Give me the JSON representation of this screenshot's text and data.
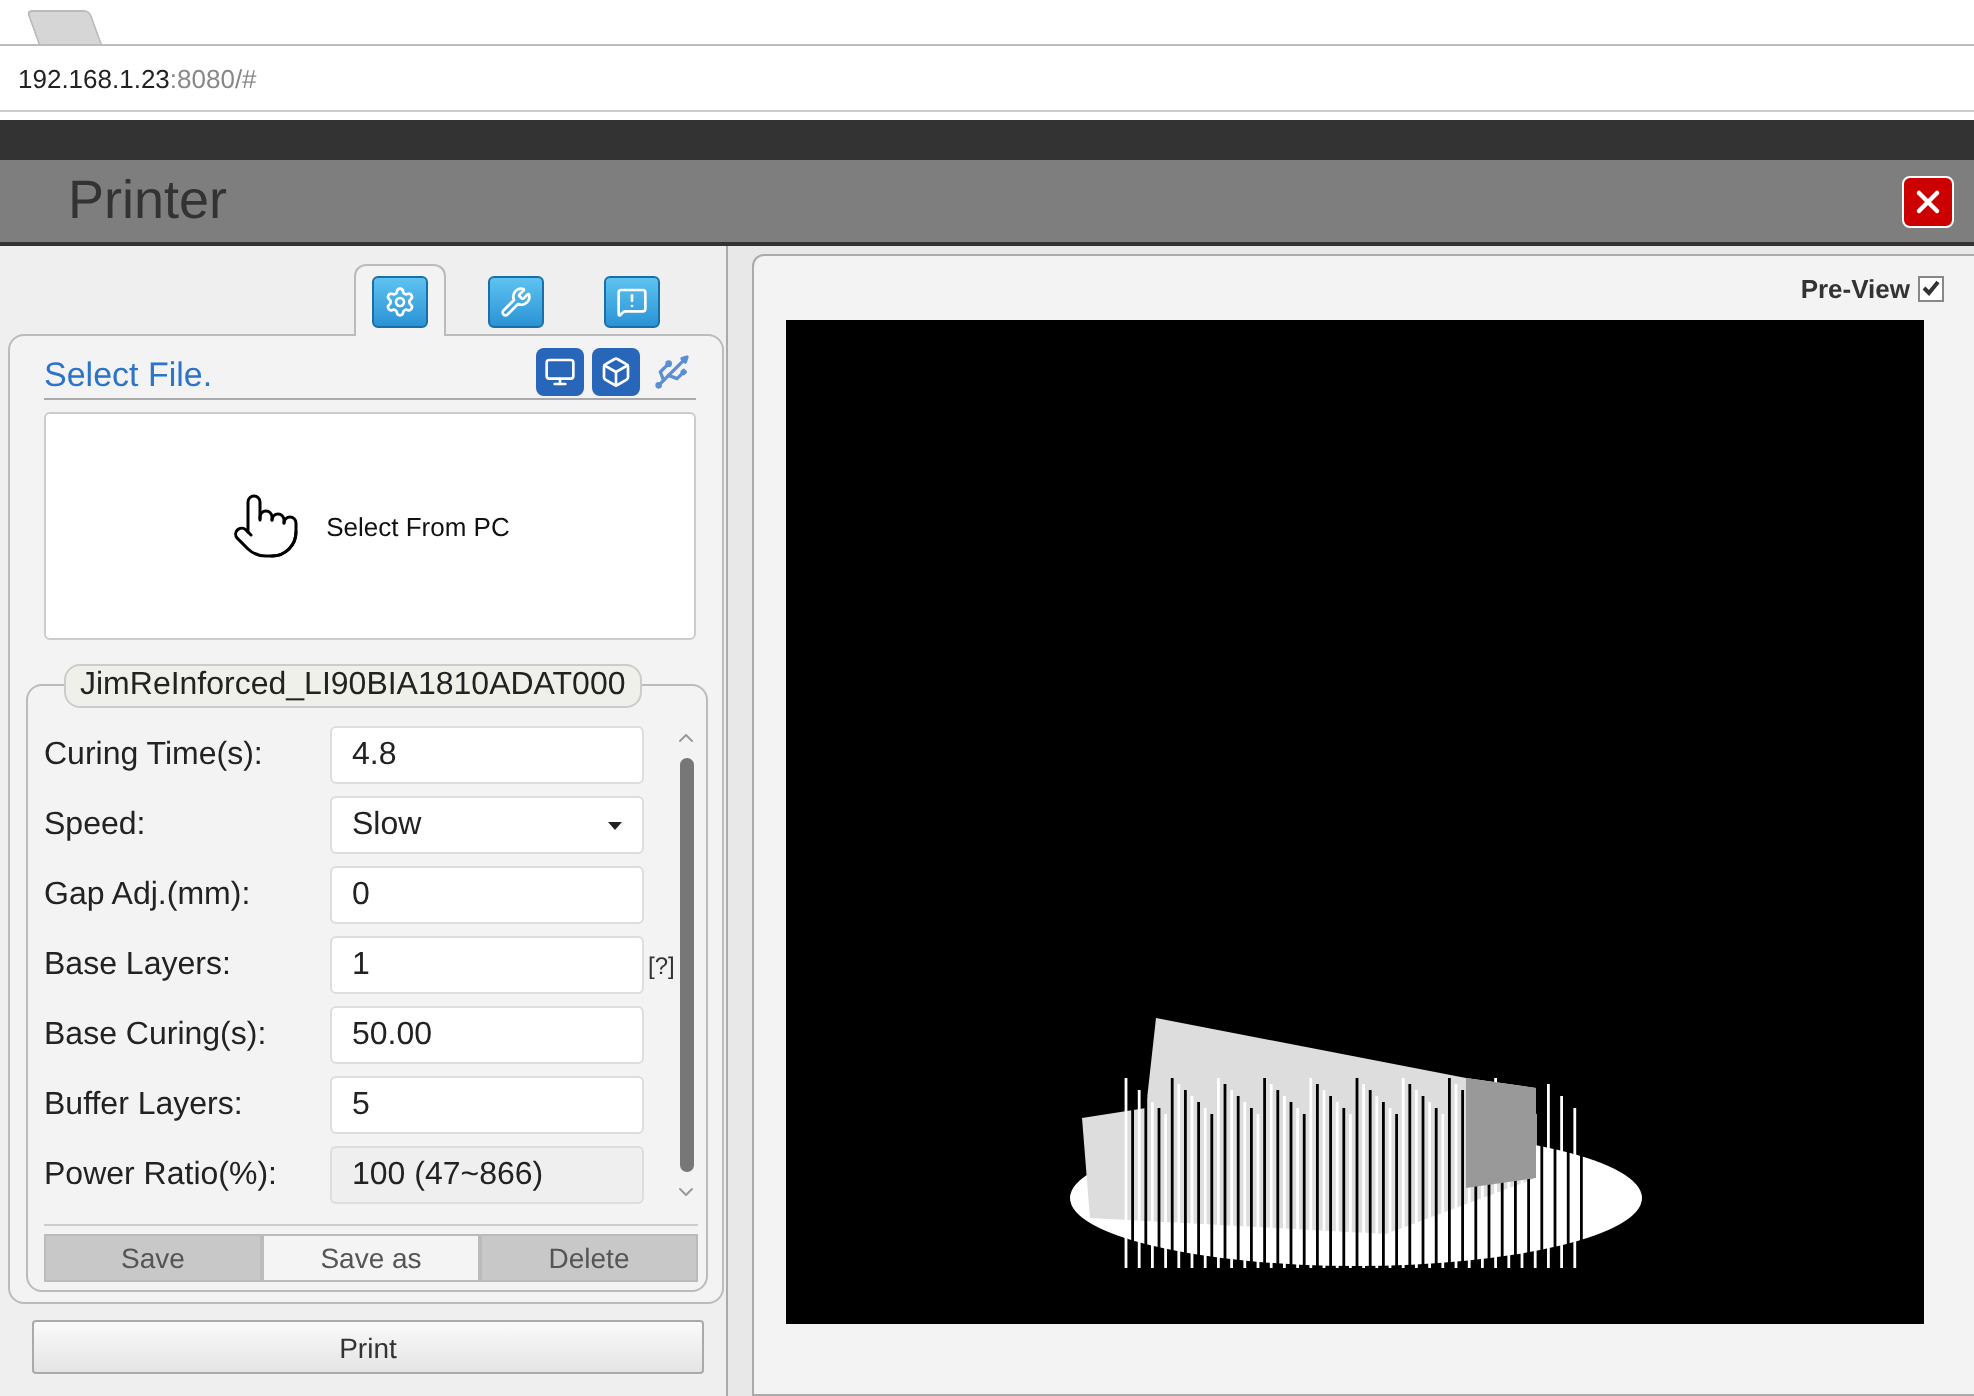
{
  "browser": {
    "url_host": "192.168.1.23",
    "url_rest": ":8080/#"
  },
  "window": {
    "title": "Printer"
  },
  "tabs": [
    {
      "kind": "settings",
      "selected": true
    },
    {
      "kind": "tools",
      "selected": false
    },
    {
      "kind": "info",
      "selected": false
    }
  ],
  "file_panel": {
    "title": "Select File.",
    "sources": [
      {
        "kind": "computer"
      },
      {
        "kind": "cube"
      },
      {
        "kind": "usb"
      }
    ],
    "drop_area": "Select From PC"
  },
  "profile": {
    "name": "JimReInforced_LI90BIA1810ADAT000",
    "fields": [
      {
        "label": "Curing Time(s):",
        "value": "4.8",
        "kind": "text",
        "disabled": false
      },
      {
        "label": "Speed:",
        "value": "Slow",
        "kind": "select",
        "disabled": false
      },
      {
        "label": "Gap Adj.(mm):",
        "value": "0",
        "kind": "text",
        "disabled": false
      },
      {
        "label": "Base Layers:",
        "value": "1",
        "kind": "text",
        "disabled": false,
        "hint": "[?]"
      },
      {
        "label": "Base Curing(s):",
        "value": "50.00",
        "kind": "text",
        "disabled": false
      },
      {
        "label": "Buffer Layers:",
        "value": "5",
        "kind": "text",
        "disabled": false
      },
      {
        "label": "Power Ratio(%):",
        "value": "100 (47~866)",
        "kind": "text",
        "disabled": true
      }
    ],
    "buttons": [
      {
        "label": "Save",
        "disabled": true
      },
      {
        "label": "Save as",
        "disabled": false
      },
      {
        "label": "Delete",
        "disabled": true
      }
    ]
  },
  "print_button": "Print",
  "preview": {
    "label": "Pre-View",
    "checked": true
  }
}
